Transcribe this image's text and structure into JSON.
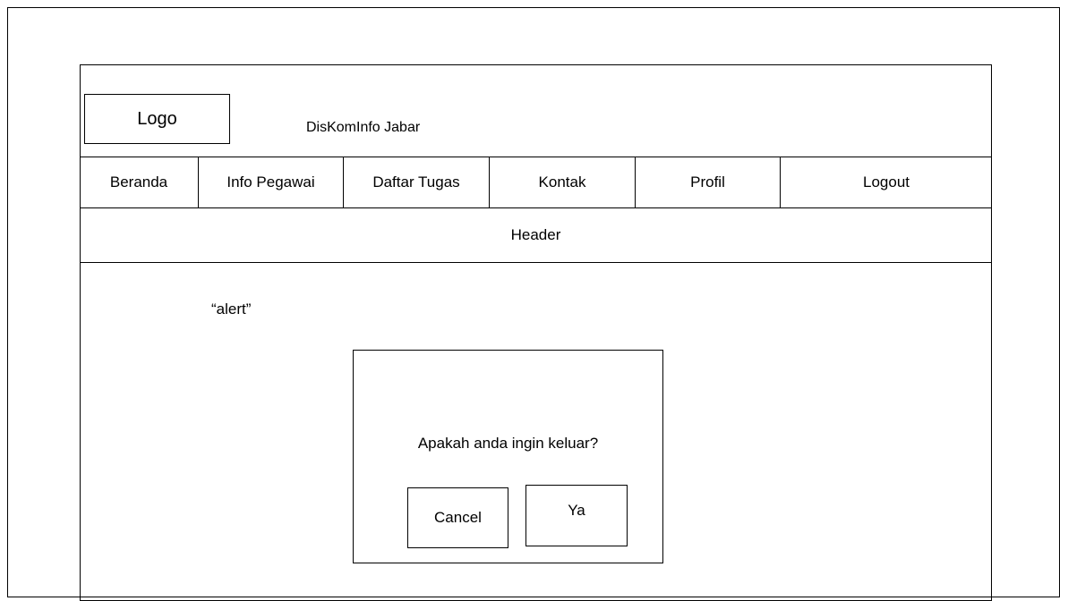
{
  "site": {
    "logo_label": "Logo",
    "title": "DisKomInfo Jabar"
  },
  "nav": {
    "items": [
      {
        "label": "Beranda"
      },
      {
        "label": "Info Pegawai"
      },
      {
        "label": "Daftar Tugas"
      },
      {
        "label": "Kontak"
      },
      {
        "label": "Profil"
      },
      {
        "label": "Logout"
      }
    ]
  },
  "header": {
    "label": "Header"
  },
  "content": {
    "alert_label": "“alert”"
  },
  "dialog": {
    "message": "Apakah anda ingin keluar?",
    "cancel_label": "Cancel",
    "confirm_label": "Ya"
  }
}
